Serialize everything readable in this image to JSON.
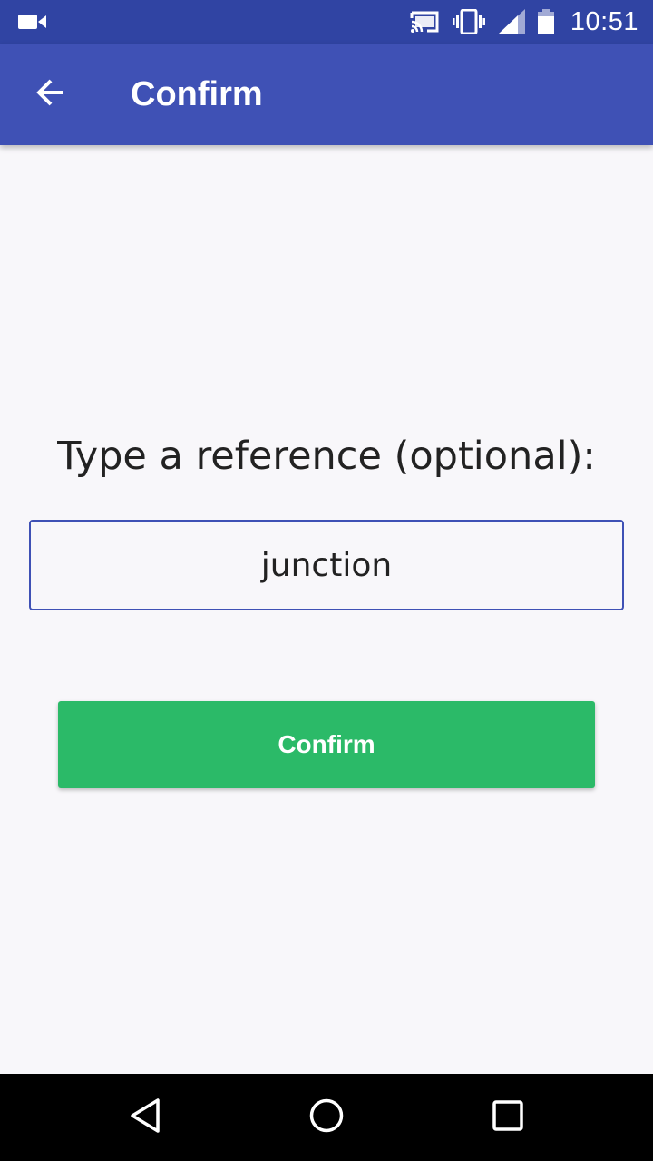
{
  "status_bar": {
    "time": "10:51",
    "icons": [
      "video-camera-icon",
      "cast-icon",
      "vibrate-icon",
      "signal-icon",
      "battery-icon"
    ]
  },
  "app_bar": {
    "title": "Confirm",
    "back_icon": "arrow-back-icon"
  },
  "form": {
    "prompt": "Type a reference (optional):",
    "reference_value": "junction",
    "confirm_label": "Confirm"
  },
  "nav_bar": {
    "icons": [
      "nav-back-icon",
      "nav-home-icon",
      "nav-recents-icon"
    ]
  },
  "colors": {
    "status_bar": "#3044a3",
    "app_bar": "#3f51b5",
    "background": "#f8f7fa",
    "confirm_button": "#2bba68",
    "input_border": "#3f51b5",
    "nav_bar": "#000000"
  }
}
